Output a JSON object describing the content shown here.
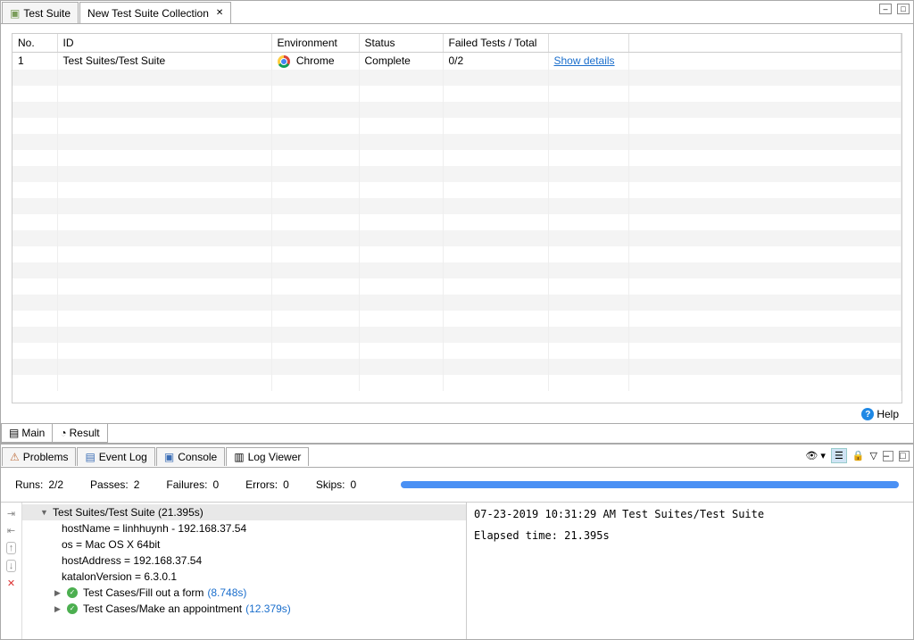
{
  "tabs": {
    "inactive": "Test Suite",
    "active": "New Test Suite Collection"
  },
  "table": {
    "headers": [
      "No.",
      "ID",
      "Environment",
      "Status",
      "Failed Tests / Total",
      "",
      ""
    ],
    "row": {
      "no": "1",
      "id": "Test Suites/Test Suite",
      "env": "Chrome",
      "status": "Complete",
      "failed": "0/2",
      "link": "Show details"
    }
  },
  "help": "Help",
  "midTabs": {
    "main": "Main",
    "result": "Result"
  },
  "bottomTabs": {
    "problems": "Problems",
    "eventlog": "Event Log",
    "console": "Console",
    "logviewer": "Log Viewer"
  },
  "stats": {
    "runsLabel": "Runs:",
    "runs": "2/2",
    "passesLabel": "Passes:",
    "passes": "2",
    "failuresLabel": "Failures:",
    "failures": "0",
    "errorsLabel": "Errors:",
    "errors": "0",
    "skipsLabel": "Skips:",
    "skips": "0"
  },
  "tree": {
    "root": "Test Suites/Test Suite (21.395s)",
    "host": "hostName = linhhuynh - 192.168.37.54",
    "os": "os = Mac OS X 64bit",
    "addr": "hostAddress = 192.168.37.54",
    "ver": "katalonVersion = 6.3.0.1",
    "tc1": "Test Cases/Fill out a form",
    "tc1t": "(8.748s)",
    "tc2": "Test Cases/Make an appointment",
    "tc2t": "(12.379s)"
  },
  "logOutput": {
    "line1": "07-23-2019 10:31:29 AM Test Suites/Test Suite",
    "line2": "Elapsed time: 21.395s"
  }
}
